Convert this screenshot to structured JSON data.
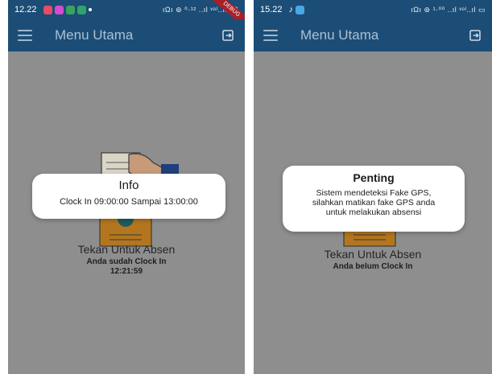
{
  "screens": [
    {
      "status_bar": {
        "time": "12.22",
        "right_text": "ıΩı ⊚ ⁰·¹² ..ıl ᵛᵒˡ..ıl 89",
        "debug_badge": "DEBUG",
        "notification_colors": [
          "#e84a6a",
          "#d84bd0",
          "#3aa35b",
          "#30a46c"
        ]
      },
      "app_bar": {
        "title": "Menu Utama",
        "menu_icon": "hamburger-icon",
        "action_icon": "logout-icon"
      },
      "main": {
        "tap_label": "Tekan Untuk Absen",
        "status_lines": [
          "Anda sudah Clock In",
          "12:21:59"
        ]
      },
      "dialog": {
        "title": "Info",
        "message_lines": [
          "Clock In 09:00:00 Sampai 13:00:00"
        ]
      }
    },
    {
      "status_bar": {
        "time": "15.22",
        "right_text": "ıΩı ⊚ ¹·⁰⁰ ..ıl ᵛᵒˡ..ıl ▭",
        "notification_colors": [
          "#ffffff",
          "#49a8e8"
        ]
      },
      "app_bar": {
        "title": "Menu Utama",
        "menu_icon": "hamburger-icon",
        "action_icon": "logout-icon"
      },
      "main": {
        "tap_label": "Tekan Untuk Absen",
        "status_lines": [
          "Anda belum Clock In"
        ]
      },
      "dialog": {
        "title": "Penting",
        "message_lines": [
          "Sistem mendeteksi Fake GPS,",
          "silahkan matikan fake GPS anda",
          "untuk melakukan absensi"
        ]
      }
    }
  ],
  "colors": {
    "app_bar": "#1c4d76",
    "scrim": "#8e8e8e",
    "dialog_bg": "#ffffff"
  }
}
